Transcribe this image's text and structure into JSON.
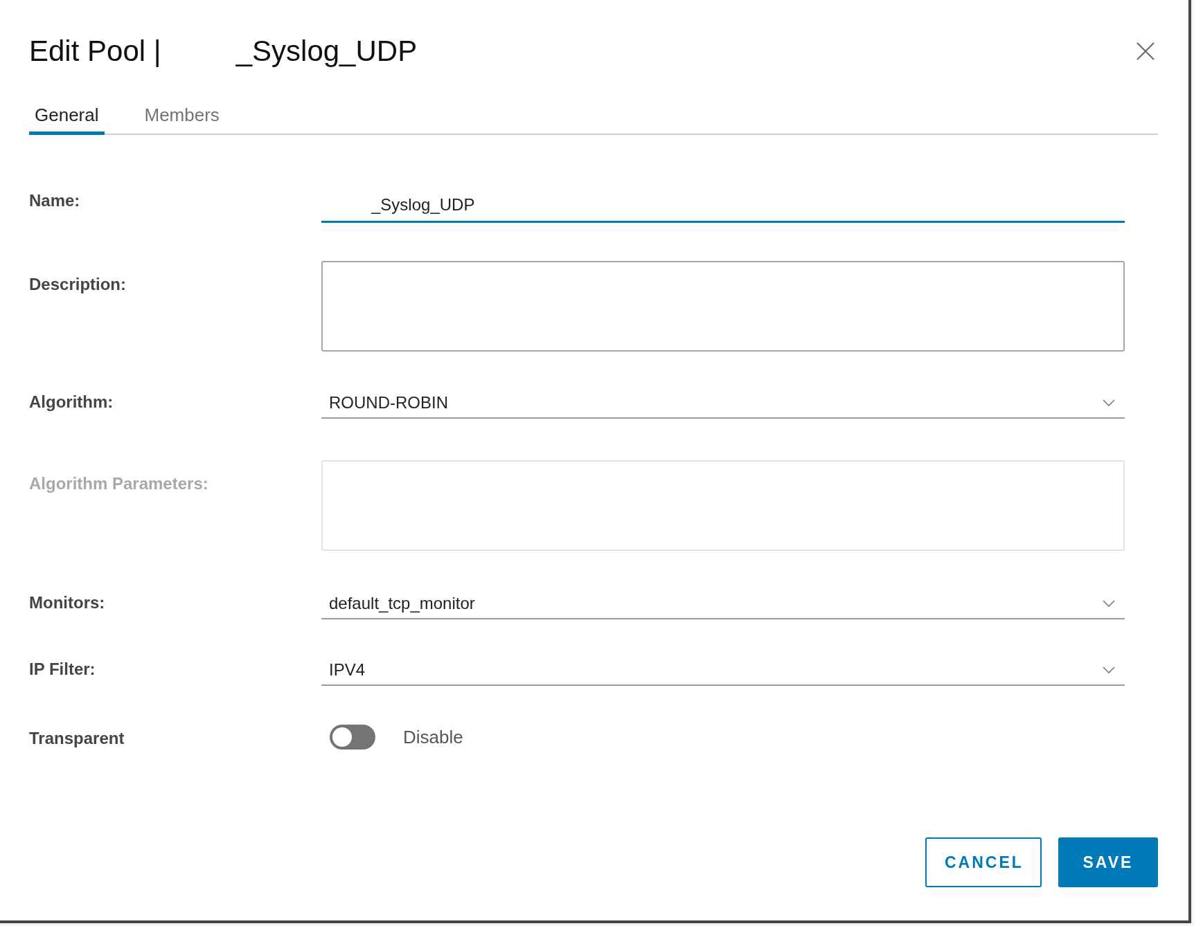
{
  "dialog": {
    "title": "Edit Pool |",
    "title_name": "_Syslog_UDP"
  },
  "tabs": [
    {
      "label": "General",
      "selected": true
    },
    {
      "label": "Members",
      "selected": false
    }
  ],
  "fields": [
    {
      "kind": "text",
      "label": "Name:",
      "value": "_Syslog_UDP",
      "focused": true,
      "disabled": false
    },
    {
      "kind": "textarea",
      "label": "Description:",
      "disabled": false
    },
    {
      "kind": "select",
      "label": "Algorithm:",
      "value": "ROUND-ROBIN",
      "disabled": false
    },
    {
      "kind": "textarea",
      "label": "Algorithm Parameters:",
      "disabled": true
    },
    {
      "kind": "select",
      "label": "Monitors:",
      "value": "default_tcp_monitor",
      "disabled": false
    },
    {
      "kind": "select",
      "label": "IP Filter:",
      "value": "IPV4",
      "disabled": false
    },
    {
      "kind": "toggle",
      "label": "Transparent",
      "on": false,
      "value_label": "Disable",
      "disabled": false
    }
  ],
  "buttons": [
    {
      "label": "CANCEL",
      "kind": "secondary"
    },
    {
      "label": "SAVE",
      "kind": "primary"
    }
  ]
}
